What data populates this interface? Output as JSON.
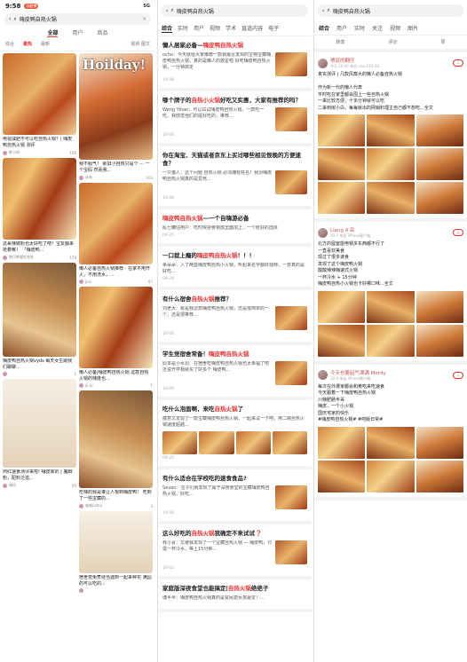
{
  "p1": {
    "time": "9:58",
    "pill": "小红书",
    "status_right": "5G",
    "search": {
      "value": "嗨皮鸭自热火锅",
      "cancel": "×"
    },
    "tabs": [
      "全部",
      "用户",
      "商品"
    ],
    "subtabs": [
      "综合",
      "最热",
      "最新"
    ],
    "subtabs_right": "视频 图文",
    "left": [
      {
        "title": "电视减肥不可以吃自热火锅？| 嗨皮鸭自热火锅 测评",
        "user": "影小妍",
        "likes": "106",
        "h": 92,
        "v": ""
      },
      {
        "title": "这辈辣椒粉也太好吃了吧！宝友都来抢着嘛！ 「嗨皮鸭...",
        "user": "熊仔熊猫吃吃吃",
        "likes": "179",
        "h": 92,
        "v": "c"
      },
      {
        "title": "嗨皮鸭自热火锅vyds 每天女生跟我们聊聊...",
        "user": "",
        "likes": "1",
        "h": 106,
        "v": "d"
      },
      {
        "title": "阿红速食测评来啦! 嗨皮家的 | 魔脚粉，配料泛滥...",
        "user": "嗨问",
        "likes": "95",
        "h": 100,
        "v": "p"
      }
    ],
    "right": [
      {
        "title": "我不服气！ 那屏小自热只是个 ··· 一个宝码 然而我...",
        "user": "赤有",
        "likes": "103",
        "h": 120,
        "v": "b",
        "holiday": "Hoilday!"
      },
      {
        "title": "懒人必备自热火锅推荐 - 在家不用开火，不用洗水，...",
        "user": "Jcai",
        "likes": "97",
        "h": 92,
        "v": ""
      },
      {
        "title": "懒人必备|嗨皮鸭自热火锅 这款自热火锅的辣度也...",
        "user": "bi bi",
        "likes": "1",
        "h": 92,
        "v": "c"
      },
      {
        "title": "吃辣的我是谁让人根到嗨皮鸭！ 吃到了一些宝藏的...",
        "user": "喵喵Lamy",
        "likes": "3",
        "h": 110,
        "v": "d"
      },
      {
        "title": "宿舍党免煮便当遇到一起来种花 满园的可以吃的...",
        "user": "",
        "likes": "",
        "h": 70,
        "v": "p"
      }
    ]
  },
  "p2": {
    "search": "嗨皮鸭自热火锅",
    "tabs": [
      "综合",
      "实时",
      "用户",
      "视频",
      "学术",
      "直选内容",
      "电子"
    ],
    "results": [
      {
        "title_a": "懒人居家必备—",
        "title_hl": "嗨皮鸭自热火锅",
        "title_b": "",
        "snip": "ocho：今天就给大家推荐一款我最近发现的宝物宝藏嗨皮鸭自热火锅，真的是懒人的救星啦 好吃嗨皮鸭自热火锅，一分钟搞定",
        "date": "10-08",
        "thumb": true
      },
      {
        "title_a": "哪个牌子的",
        "title_hl": "自热小火锅",
        "title_b": "好吃又实惠，大家有推荐的吗？",
        "snip": "Weng Yihan：可以试试嗨皮鸭自热火锅，一款吃一吃，我感觉他们的挺好吃的，推荐...",
        "date": "10-06",
        "thumb": true
      },
      {
        "title_a": "你在淘宝、天猫或者京东上买过哪些相见恨晚的方便速食？",
        "title_hl": "",
        "title_b": "",
        "snip": "一只猫人：这个问题 自热火锅 必须拥有姓名！我对嗨皮鸭自热火锅真的是爱死...",
        "date": "10-06",
        "thumb": true
      },
      {
        "title_a": "",
        "title_hl": "嗨皮鸭自热火锅",
        "title_b": "—一个自嗨游必备",
        "snip": "乱七糟估用户：吃时候把食物放里面加上...一个很好的选择",
        "date": "09-25",
        "thumb": false
      },
      {
        "title_a": "一口就上瘾的",
        "title_hl": "嗨皮鸭自热火锅",
        "title_b": "！！！",
        "snip": "幸朵朵：入了两盒嗨皮鸭自热小火锅，听起来名字都好独特，一尝真的是好吃...",
        "date": "09-24",
        "thumb": false
      },
      {
        "title_a": "有什么宿舍",
        "title_hl": "自热火锅",
        "title_b": "推荐？",
        "snip": "刘老大：就是我这款嗨皮鸭自热火锅，还是很简单的一个，还是很推荐...",
        "date": "10-06",
        "thumb": true
      },
      {
        "title_a": "学生党宿舍常备！",
        "title_hl": "嗨皮鸭自热火锅",
        "title_b": "",
        "snip": "原本是小水洞：在宿舍吃嗨皮鸭自热火锅也太幸福了吧 还说开学我就买了好多个 嗨皮鸭...",
        "date": "10-06",
        "thumb": true
      },
      {
        "title_a": "吃什么泡面啊，来吃",
        "title_hl": "自热火锅",
        "title_b": "了",
        "snip": "蕴意又发现了一款宝藏嗨皮鸭自热火锅，一起来试一下吧，用二碗自热火锅速度超越...",
        "date": "09-25",
        "thumb": false,
        "thumbs": true
      },
      {
        "title_a": "有什么适合在学校吃的速食食品?",
        "title_hl": "",
        "title_b": "",
        "snip": "Seven：宝子们我发现了属于深夜食堂的宝藏嗨皮鸭自热火锅，好吃...",
        "date": "10-06",
        "thumb": true
      },
      {
        "title_a": "这么好吃的",
        "title_hl": "自热火锅",
        "title_b": "我确定不来试试❓",
        "snip": "林小青：又被我发现了一个宝藏自热火锅 — 嗨皮鸭，只需一杯冷水，等上15分钟...",
        "date": "10-02",
        "thumb": true
      },
      {
        "title_a": "家庭版深夜食堂也能搞定|",
        "title_hl": "自热火锅",
        "title_b": "绝绝子",
        "snip": "博半半：嗨皮鸭自热火锅真的是贫民窟女孩最爱！...",
        "date": "",
        "thumb": false
      }
    ]
  },
  "p3": {
    "search": "嗨皮鸭自热火锅",
    "tabs": [
      "综合",
      "用户",
      "实时",
      "关注",
      "视频",
      "图片"
    ],
    "acts": [
      "转发",
      "评论",
      "赞"
    ],
    "posts": [
      {
        "name": "嗯就的翻仔",
        "sub": "今天 10:06 来自 vivo S10 5G",
        "text": "真实测评 | 几款风靡大的懒人必备自热火锅\n\n作为新一代的懒人代表\n平时吃在家里都会囤上一些自热火锅\n一来比较方便，十多分钟就可以吃\n二来到房小白，每每就出的网销料理主自己都不想吃...全文",
        "imgs": 9
      },
      {
        "name": "Liang 4 岳",
        "sub": "10-1 来自 iPhone客户端",
        "text": "北方的寝室能电锅多东西都不行了\n一直喜欢美食\n现过了很多速食\n发现了这个嗨皮鸭火锅\n酸酸辣辣嗨速式火锅\n一杯冷水 + 15分钟\n嗨皮鸭自热小火锅也卡好哪口味...全文",
        "imgs": 6
      },
      {
        "name": "今天也要起气满满 Merdy",
        "sub": "10-4 来自 iPhone客户端",
        "text": "每次在外遭家都会和黄吃来吃速食\n今天跟着一下嗨皮鸭自热火锅\n川辣肥肠丰哥\n嗨皮，一个小火锅\n国庆宅家的快乐\n#嗨皮鸭自热火锅# #吧版日常#",
        "imgs": 6
      }
    ]
  },
  "colors": {
    "accent": "#e33333"
  }
}
